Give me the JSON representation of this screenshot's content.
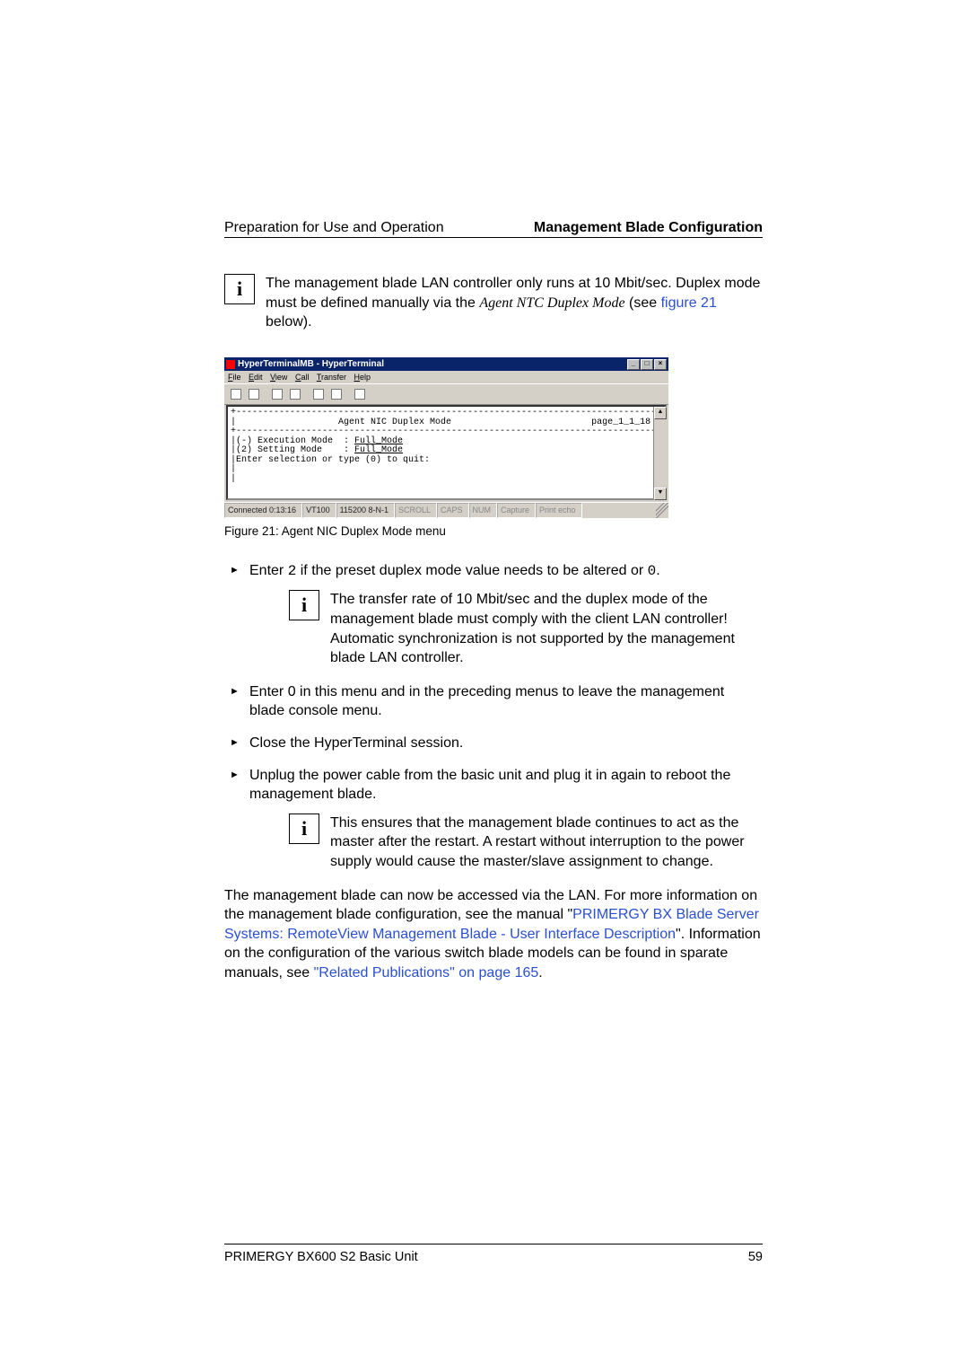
{
  "header": {
    "left": "Preparation for Use and Operation",
    "right": "Management Blade Configuration"
  },
  "info1": {
    "text_a": "The management blade LAN controller only runs at 10 Mbit/sec. Duplex mode must be defined manually via the ",
    "italic": "Agent NTC Duplex Mode",
    "text_b": " (see ",
    "link": "figure 21",
    "text_c": " below)."
  },
  "window": {
    "title": "HyperTerminalMB - HyperTerminal",
    "menu": [
      "File",
      "Edit",
      "View",
      "Call",
      "Transfer",
      "Help"
    ],
    "minimize": "_",
    "maximize": "□",
    "close": "×",
    "sb_up": "▲",
    "sb_down": "▼"
  },
  "terminal": {
    "border_top": "+------------------------------------------------------------------------------+",
    "title_line_pre": "|                   ",
    "title_text": "Agent NIC Duplex Mode",
    "title_line_mid": "                          ",
    "page": "page_1_1_18",
    "border_mid": "+------------------------------------------------------------------------------+",
    "row1_pre": "|(-) Execution Mode  : ",
    "row1_val": "Full_Mode",
    "row2_pre": "|(2) Setting Mode    : ",
    "row2_val": "Full_Mode",
    "prompt": "|Enter selection or type (0) to quit:",
    "blank_row": "|"
  },
  "statusbar": {
    "connected": "Connected 0:13:16",
    "term": "VT100",
    "baud": "115200 8-N-1",
    "scroll": "SCROLL",
    "caps": "CAPS",
    "num": "NUM",
    "capture": "Capture",
    "echo": "Print echo"
  },
  "figure_caption": "Figure 21: Agent NIC Duplex Mode menu",
  "bullets": {
    "b1_a": "Enter ",
    "b1_two": "2",
    "b1_b": " if the preset duplex mode value needs to be altered or ",
    "b1_zero": "0",
    "b1_c": ".",
    "info2": "The transfer rate of 10 Mbit/sec and the duplex mode of the management blade must comply with the client LAN controller! Automatic synchronization is not supported by the management blade LAN controller.",
    "b2": "Enter 0 in this menu and in the preceding menus to leave the management blade console menu.",
    "b3": "Close the HyperTerminal session.",
    "b4": "Unplug the power cable from the basic unit and plug it in again to reboot the management blade.",
    "info3": "This ensures that the management blade continues to act as the master after the restart. A restart without interruption to the power supply would cause the master/slave assignment to change."
  },
  "closing": {
    "a": "The management blade can now be accessed via the LAN. For more information on the management blade configuration, see the manual \"",
    "link1": "PRIMERGY BX Blade Server Systems: RemoteView Management Blade - User Interface Description",
    "b": "\". Information on the configuration of the various switch blade models can be found in sparate manuals, see ",
    "link2": "\"Related Publications\" on page 165",
    "c": "."
  },
  "footer": {
    "left": "PRIMERGY BX600 S2 Basic Unit",
    "right": "59"
  }
}
